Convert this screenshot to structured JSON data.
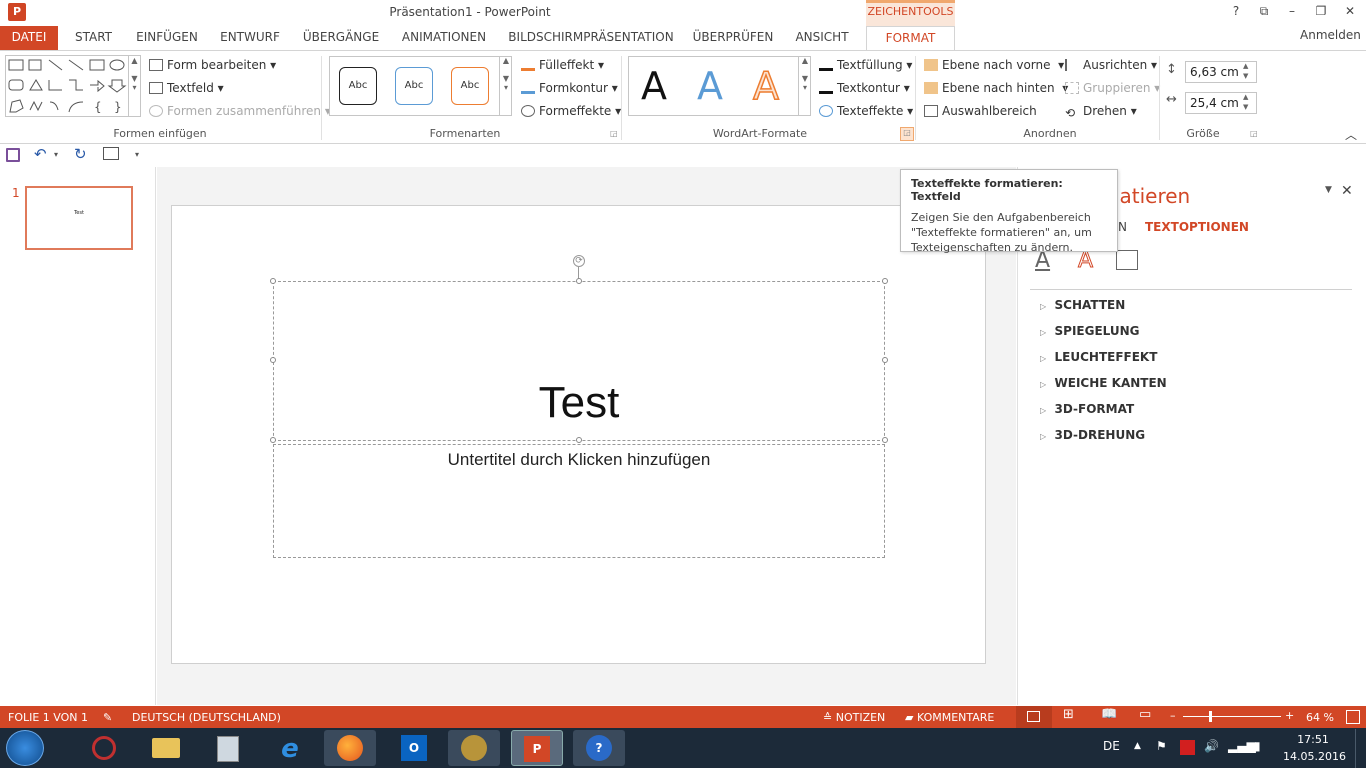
{
  "app": {
    "title": "Präsentation1 - PowerPoint",
    "icon": "P",
    "context_tools": "ZEICHENTOOLS",
    "signin": "Anmelden"
  },
  "tabs": [
    "DATEI",
    "START",
    "EINFÜGEN",
    "ENTWURF",
    "ÜBERGÄNGE",
    "ANIMATIONEN",
    "BILDSCHIRMPRÄSENTATION",
    "ÜBERPRÜFEN",
    "ANSICHT",
    "FORMAT"
  ],
  "ribbon": {
    "groups": {
      "insert_shapes": "Formen einfügen",
      "shape_styles": "Formenarten",
      "wordart": "WordArt-Formate",
      "arrange": "Anordnen",
      "size": "Größe"
    },
    "insert_shapes": {
      "edit_shape": "Form bearbeiten",
      "textbox": "Textfeld",
      "merge_shapes": "Formen zusammenführen"
    },
    "shape_styles": {
      "previews": [
        "Abc",
        "Abc",
        "Abc"
      ],
      "fill": "Fülleffekt",
      "outline": "Formkontur",
      "effects": "Formeffekte"
    },
    "wordart": {
      "previews": [
        "A",
        "A",
        "A"
      ],
      "text_fill": "Textfüllung",
      "text_outline": "Textkontur",
      "text_effects": "Texteffekte"
    },
    "arrange": {
      "bring_forward": "Ebene nach vorne",
      "send_backward": "Ebene nach hinten",
      "selection_pane": "Auswahlbereich",
      "align": "Ausrichten",
      "group": "Gruppieren",
      "rotate": "Drehen"
    },
    "size": {
      "height": "6,63  cm",
      "width": "25,4  cm"
    }
  },
  "slides": {
    "number": "1",
    "thumb_title": "Test"
  },
  "slide": {
    "title": "Test",
    "subtitle": "Untertitel durch Klicken hinzufügen"
  },
  "pane": {
    "title_visible": "matieren",
    "tab_left_visible": "N",
    "tab_right": "TEXTOPTIONEN",
    "sections": [
      "SCHATTEN",
      "SPIEGELUNG",
      "LEUCHTEFFEKT",
      "WEICHE KANTEN",
      "3D-FORMAT",
      "3D-DREHUNG"
    ]
  },
  "tooltip": {
    "title": "Texteffekte formatieren: Textfeld",
    "body": "Zeigen Sie den Aufgabenbereich \"Texteffekte formatieren\" an, um Texteigenschaften zu ändern."
  },
  "status": {
    "slide": "FOLIE 1 VON 1",
    "language": "DEUTSCH (DEUTSCHLAND)",
    "notes": "NOTIZEN",
    "comments": "KOMMENTARE",
    "zoom_minus": "–",
    "zoom_plus": "+",
    "zoom": "64 %"
  },
  "taskbar": {
    "lang": "DE",
    "time": "17:51",
    "date": "14.05.2016"
  },
  "colors": {
    "accent": "#d24726",
    "taskbar": "#1c2a39"
  }
}
